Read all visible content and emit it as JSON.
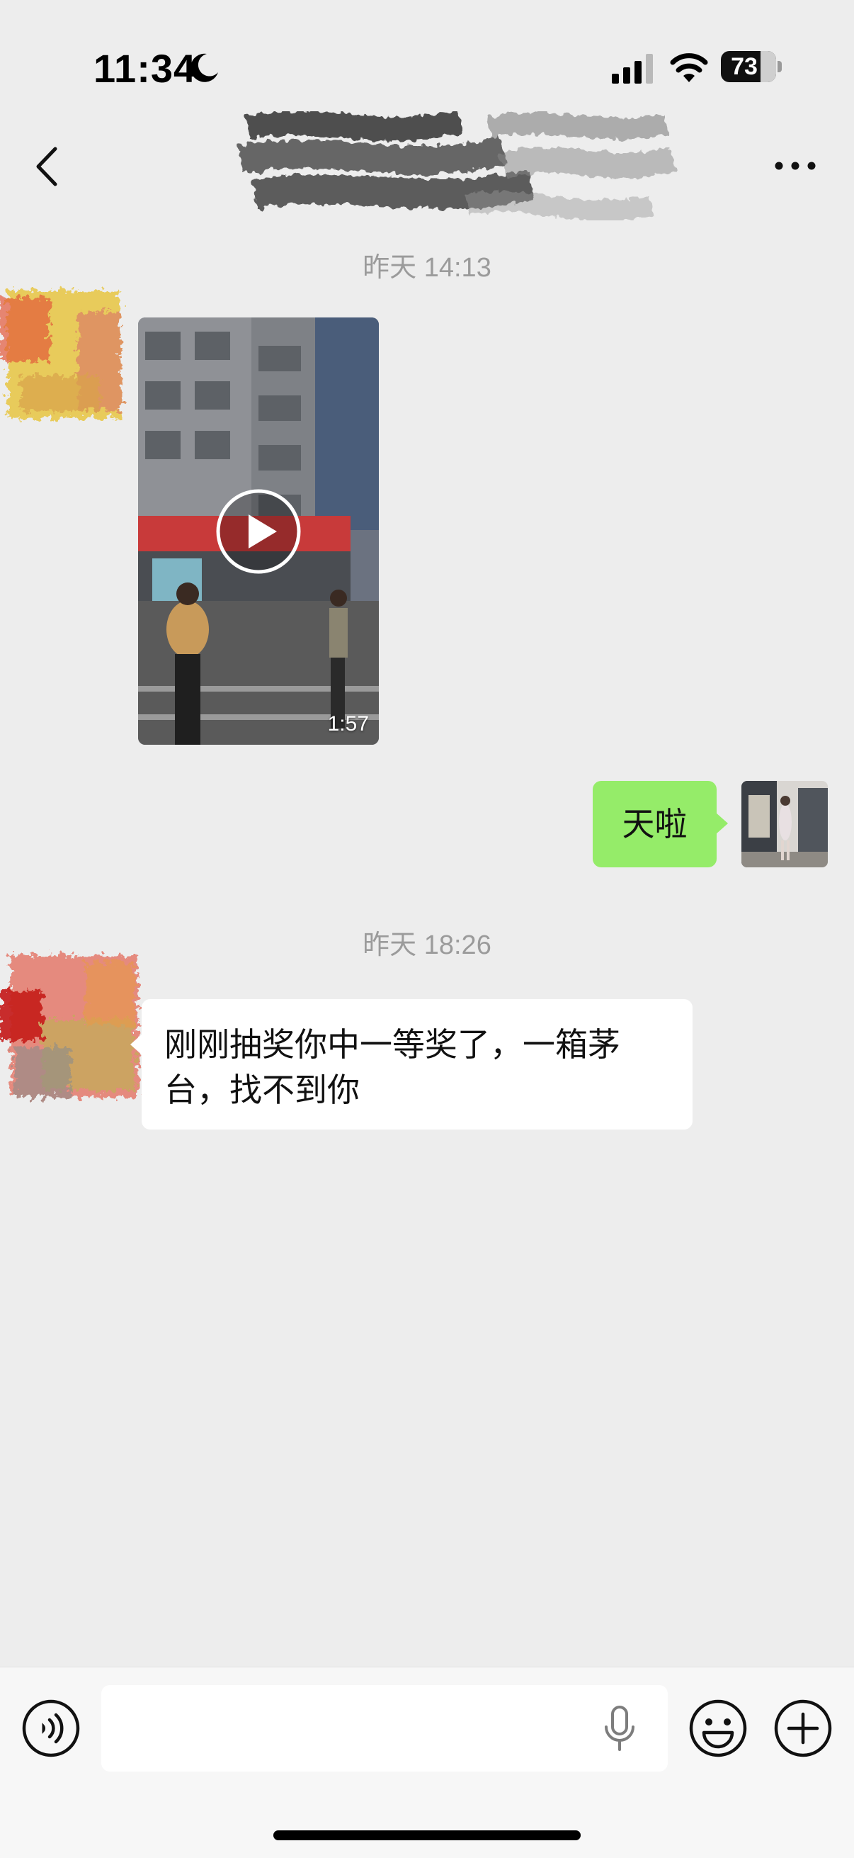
{
  "status_bar": {
    "time": "11:34",
    "battery": "73",
    "icons": [
      "moon-icon",
      "cellular-signal-icon",
      "wifi-icon",
      "battery-icon"
    ]
  },
  "nav": {
    "back_icon": "chevron-left-icon",
    "more_icon": "ellipsis-icon"
  },
  "messages": [
    {
      "type": "timestamp",
      "text": "昨天 14:13"
    },
    {
      "type": "video",
      "direction": "incoming",
      "duration": "1:57",
      "icon": "play-icon"
    },
    {
      "type": "text",
      "direction": "outgoing",
      "text": "天啦"
    },
    {
      "type": "timestamp",
      "text": "昨天 18:26"
    },
    {
      "type": "text",
      "direction": "incoming",
      "text": "刚刚抽奖你中一等奖了，一箱茅台，找不到你"
    }
  ],
  "input_bar": {
    "voice_icon": "voice-mode-icon",
    "input_value": "",
    "mic_icon": "microphone-icon",
    "emoji_icon": "emoji-icon",
    "plus_icon": "plus-icon"
  },
  "colors": {
    "background": "#ededed",
    "outgoing_bubble": "#95ec69",
    "incoming_bubble": "#ffffff",
    "timestamp_text": "#9b9b9b"
  }
}
